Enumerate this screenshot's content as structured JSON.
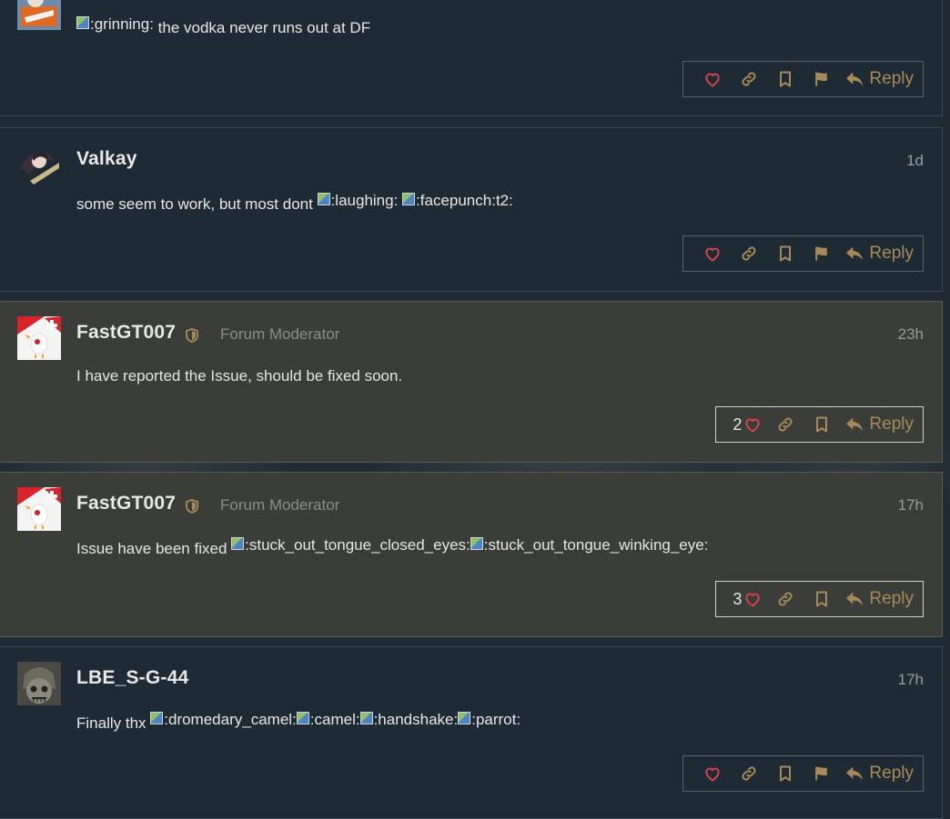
{
  "posts": [
    {
      "username": "",
      "time": "",
      "body_text": "the vodka never runs out at DF",
      "emojis_before": [
        ":grinning:"
      ],
      "emojis_after": [],
      "likes": "",
      "reply_label": "Reply"
    },
    {
      "username": "Valkay",
      "time": "1d",
      "body_text": "some seem to work, but most dont",
      "emojis_after": [
        ":laughing:",
        ":facepunch:t2:"
      ],
      "likes": "",
      "reply_label": "Reply"
    },
    {
      "username": "FastGT007",
      "title": "Forum Moderator",
      "time": "23h",
      "body_text": "I have reported the Issue, should be fixed soon.",
      "emojis_after": [],
      "likes": "2",
      "reply_label": "Reply"
    },
    {
      "username": "FastGT007",
      "title": "Forum Moderator",
      "time": "17h",
      "body_text": "Issue have been fixed",
      "emojis_after": [
        ":stuck_out_tongue_closed_eyes:",
        ":stuck_out_tongue_winking_eye:"
      ],
      "likes": "3",
      "reply_label": "Reply"
    },
    {
      "username": "LBE_S-G-44",
      "time": "17h",
      "body_text": "Finally thx",
      "emojis_after": [
        ":dromedary_camel:",
        ":camel:",
        ":handshake:",
        ":parrot:"
      ],
      "likes": "",
      "reply_label": "Reply"
    }
  ],
  "colors": {
    "accent": "#a88a58",
    "heart": "#e0434f",
    "background": "#1f2a33",
    "moderator_background": "#3a3d38"
  },
  "icons": [
    "heart-icon",
    "link-icon",
    "bookmark-icon",
    "flag-icon",
    "reply-arrow-icon",
    "moderator-shield-icon"
  ]
}
